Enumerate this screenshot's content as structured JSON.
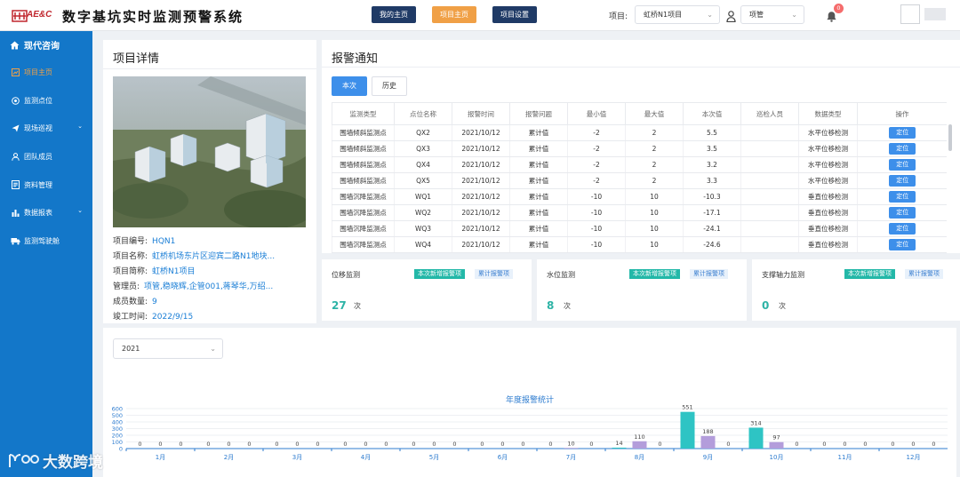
{
  "header": {
    "brand": "AE&C",
    "title": "数字基坑实时监测预警系统",
    "tabs": [
      {
        "label": "我的主页",
        "color": "#1f3a66"
      },
      {
        "label": "项目主页",
        "color": "#f0a046"
      },
      {
        "label": "项目设置",
        "color": "#1f3a66"
      }
    ],
    "project_label": "项目:",
    "project_value": "虹桥N1项目",
    "role_value": "项管",
    "notification_count": "0"
  },
  "sidebar": {
    "title": "现代咨询",
    "items": [
      {
        "label": "项目主页",
        "icon": "chart-icon",
        "active": true
      },
      {
        "label": "监测点位",
        "icon": "target-icon"
      },
      {
        "label": "现场巡视",
        "icon": "send-icon",
        "expandable": true
      },
      {
        "label": "团队成员",
        "icon": "user-icon"
      },
      {
        "label": "资料管理",
        "icon": "document-icon"
      },
      {
        "label": "数据报表",
        "icon": "bar-chart-icon",
        "expandable": true
      },
      {
        "label": "监测驾驶舱",
        "icon": "truck-icon"
      }
    ]
  },
  "project": {
    "title": "项目详情",
    "fields": [
      {
        "label": "项目编号:",
        "value": "HQN1"
      },
      {
        "label": "项目名称:",
        "value": "虹桥机场东片区迎宾二路N1地块..."
      },
      {
        "label": "项目简称:",
        "value": "虹桥N1项目"
      },
      {
        "label": "管理员:",
        "value": "项管,稳晓辉,企管001,蒋琴华,万绍..."
      },
      {
        "label": "成员数量:",
        "value": "9"
      },
      {
        "label": "竣工时间:",
        "value": "2022/9/15"
      }
    ]
  },
  "alarms": {
    "title": "报警通知",
    "tabs": [
      "本次",
      "历史"
    ],
    "columns": [
      "监测类型",
      "点位名称",
      "报警时间",
      "报警问题",
      "最小值",
      "最大值",
      "本次值",
      "巡检人员",
      "数据类型",
      "操作"
    ],
    "action_label": "定位",
    "rows": [
      [
        "围墙倾斜监测点",
        "QX2",
        "2021/10/12",
        "累计值",
        "-2",
        "2",
        "5.5",
        "",
        "水平位移检测"
      ],
      [
        "围墙倾斜监测点",
        "QX3",
        "2021/10/12",
        "累计值",
        "-2",
        "2",
        "3.5",
        "",
        "水平位移检测"
      ],
      [
        "围墙倾斜监测点",
        "QX4",
        "2021/10/12",
        "累计值",
        "-2",
        "2",
        "3.2",
        "",
        "水平位移检测"
      ],
      [
        "围墙倾斜监测点",
        "QX5",
        "2021/10/12",
        "累计值",
        "-2",
        "2",
        "3.3",
        "",
        "水平位移检测"
      ],
      [
        "围墙沉降监测点",
        "WQ1",
        "2021/10/12",
        "累计值",
        "-10",
        "10",
        "-10.3",
        "",
        "垂直位移检测"
      ],
      [
        "围墙沉降监测点",
        "WQ2",
        "2021/10/12",
        "累计值",
        "-10",
        "10",
        "-17.1",
        "",
        "垂直位移检测"
      ],
      [
        "围墙沉降监测点",
        "WQ3",
        "2021/10/12",
        "累计值",
        "-10",
        "10",
        "-24.1",
        "",
        "垂直位移检测"
      ],
      [
        "围墙沉降监测点",
        "WQ4",
        "2021/10/12",
        "累计值",
        "-10",
        "10",
        "-24.6",
        "",
        "垂直位移检测"
      ]
    ]
  },
  "stats": [
    {
      "title": "位移监测",
      "new_tag": "本次新增报警项",
      "cum_tag": "累计报警项",
      "count": "27",
      "unit": "次"
    },
    {
      "title": "水位监测",
      "new_tag": "本次新增报警项",
      "cum_tag": "累计报警项",
      "count": "8",
      "unit": "次"
    },
    {
      "title": "支撑轴力监测",
      "new_tag": "本次新增报警项",
      "cum_tag": "累计报警项",
      "count": "0",
      "unit": "次"
    }
  ],
  "year_select": "2021",
  "watermark": "大数跨境",
  "chart_data": {
    "type": "bar",
    "title": "年度报警统计",
    "categories": [
      "1月",
      "2月",
      "3月",
      "4月",
      "5月",
      "6月",
      "7月",
      "8月",
      "9月",
      "10月",
      "11月",
      "12月"
    ],
    "series": [
      {
        "color": "#2ec4c4",
        "values": [
          0,
          0,
          0,
          0,
          0,
          0,
          0,
          14,
          551,
          314,
          0,
          0
        ]
      },
      {
        "color": "#b39ddb",
        "values": [
          0,
          0,
          0,
          0,
          0,
          0,
          10,
          110,
          188,
          97,
          0,
          0
        ]
      },
      {
        "color": "#7aa8e0",
        "values": [
          0,
          0,
          0,
          0,
          0,
          0,
          0,
          0,
          0,
          0,
          0,
          0
        ]
      }
    ],
    "y_ticks": [
      "600",
      "500",
      "400",
      "300",
      "200",
      "100",
      "0"
    ],
    "ylim": [
      0,
      600
    ],
    "grid": true
  }
}
